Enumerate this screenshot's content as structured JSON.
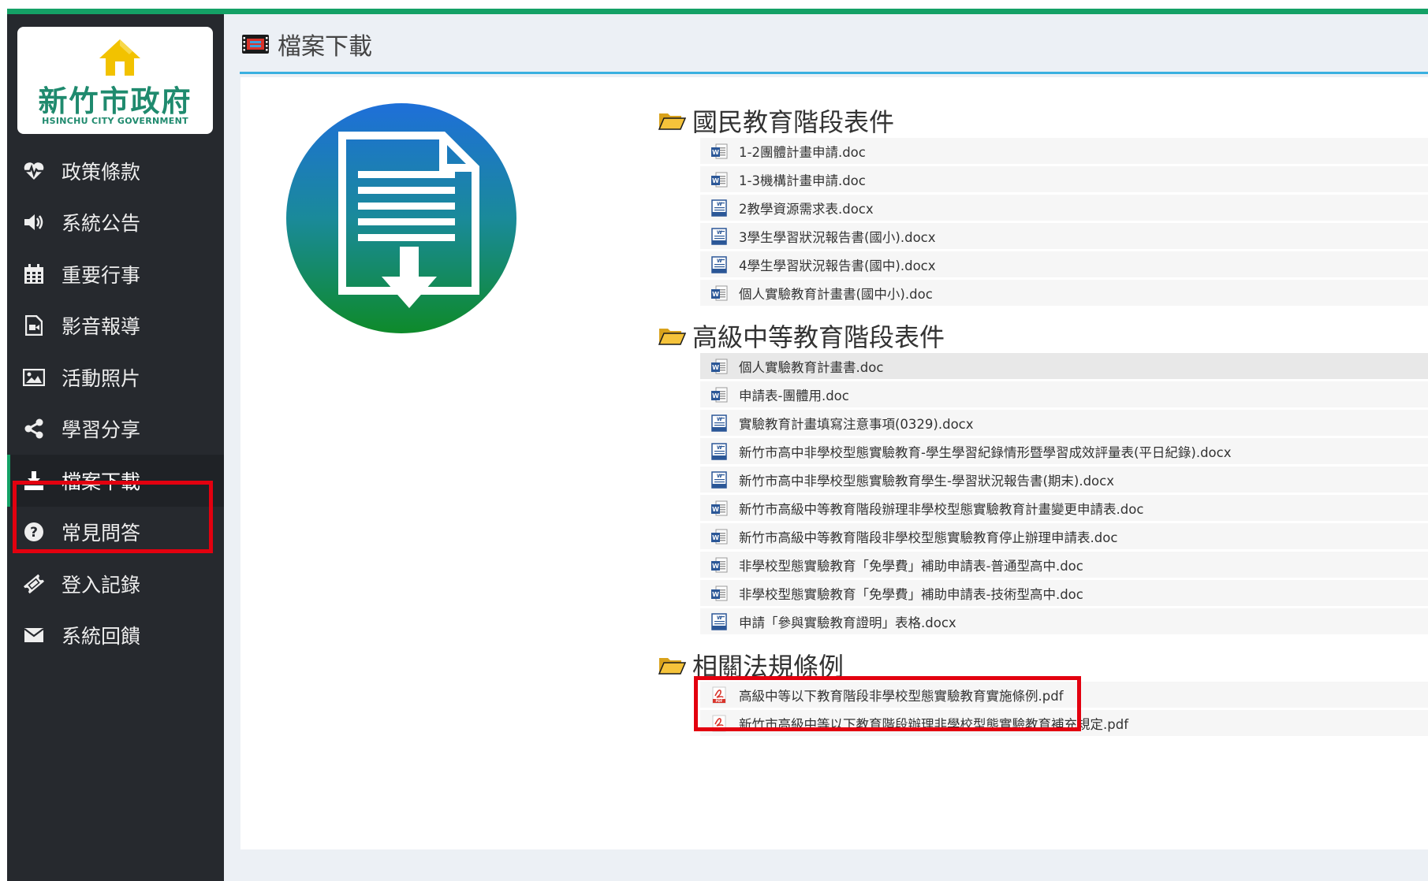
{
  "logo": {
    "cn": "新竹市政府",
    "en": "HSINCHU CITY GOVERNMENT"
  },
  "nav": [
    {
      "label": "政策條款",
      "icon": "heartbeat-icon"
    },
    {
      "label": "系統公告",
      "icon": "volume-icon"
    },
    {
      "label": "重要行事",
      "icon": "calendar-icon"
    },
    {
      "label": "影音報導",
      "icon": "video-file-icon"
    },
    {
      "label": "活動照片",
      "icon": "picture-icon"
    },
    {
      "label": "學習分享",
      "icon": "share-icon"
    },
    {
      "label": "檔案下載",
      "icon": "download-icon",
      "active": true
    },
    {
      "label": "常見問答",
      "icon": "question-circle-icon"
    },
    {
      "label": "登入記錄",
      "icon": "ticket-icon"
    },
    {
      "label": "系統回饋",
      "icon": "envelope-icon"
    }
  ],
  "header": {
    "title": "檔案下載"
  },
  "sections": [
    {
      "title": "國民教育階段表件",
      "files": [
        {
          "name": "1-2團體計畫申請.doc",
          "type": "doc"
        },
        {
          "name": "1-3機構計畫申請.doc",
          "type": "doc"
        },
        {
          "name": "2教學資源需求表.docx",
          "type": "docx"
        },
        {
          "name": "3學生學習狀況報告書(國小).docx",
          "type": "docx"
        },
        {
          "name": "4學生學習狀況報告書(國中).docx",
          "type": "docx"
        },
        {
          "name": "個人實驗教育計畫書(國中小).doc",
          "type": "doc"
        }
      ]
    },
    {
      "title": "高級中等教育階段表件",
      "files": [
        {
          "name": "個人實驗教育計畫書.doc",
          "type": "doc"
        },
        {
          "name": "申請表-團體用.doc",
          "type": "doc"
        },
        {
          "name": "實驗教育計畫填寫注意事項(0329).docx",
          "type": "docx"
        },
        {
          "name": "新竹市高中非學校型態實驗教育-學生學習紀錄情形暨學習成效評量表(平日紀錄).docx",
          "type": "docx"
        },
        {
          "name": "新竹市高中非學校型態實驗教育學生-學習狀況報告書(期末).docx",
          "type": "docx"
        },
        {
          "name": "新竹市高級中等教育階段辦理非學校型態實驗教育計畫變更申請表.doc",
          "type": "doc"
        },
        {
          "name": "新竹市高級中等教育階段非學校型態實驗教育停止辦理申請表.doc",
          "type": "doc"
        },
        {
          "name": "非學校型態實驗教育「免學費」補助申請表-普通型高中.doc",
          "type": "doc"
        },
        {
          "name": "非學校型態實驗教育「免學費」補助申請表-技術型高中.doc",
          "type": "doc"
        },
        {
          "name": "申請「參與實驗教育證明」表格.docx",
          "type": "docx"
        }
      ]
    },
    {
      "title": "相關法規條例",
      "files": [
        {
          "name": "高級中等以下教育階段非學校型態實驗教育實施條例.pdf",
          "type": "pdf"
        },
        {
          "name": "新竹市高級中等以下教育階段辦理非學校型態實驗教育補充規定.pdf",
          "type": "pdf"
        }
      ]
    }
  ],
  "colors": {
    "accent_green": "#14a166",
    "sidebar": "#26292e",
    "highlight": "#e3000f",
    "header_line": "#3ab0e0"
  }
}
